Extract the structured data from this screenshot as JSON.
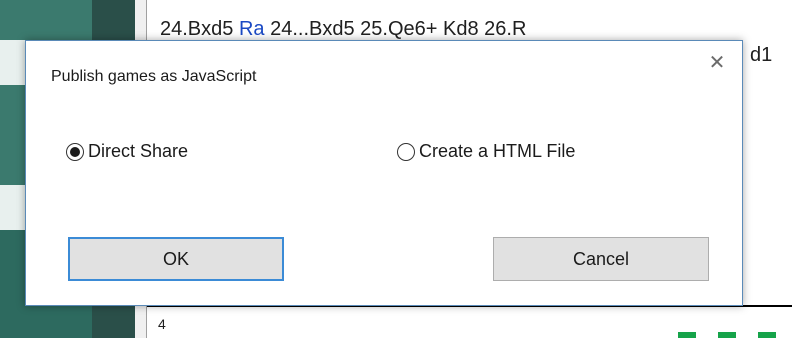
{
  "background": {
    "notation_line": [
      "24.Bxd5",
      "Ra",
      "24...Bxd5 25.Qe6+ Kd8 26.R"
    ],
    "notation_tail": "d1",
    "bottom_text": "4"
  },
  "dialog": {
    "title": "Publish games as JavaScript",
    "close_icon": "close-icon",
    "options": [
      {
        "label": "Direct Share",
        "checked": true
      },
      {
        "label": "Create a HTML File",
        "checked": false
      }
    ],
    "ok_label": "OK",
    "cancel_label": "Cancel"
  },
  "colors": {
    "accent_focus": "#3b8bd6",
    "dialog_border": "#5a8ab8",
    "notation_link": "#1a49c4",
    "status_green": "#16a34a"
  }
}
